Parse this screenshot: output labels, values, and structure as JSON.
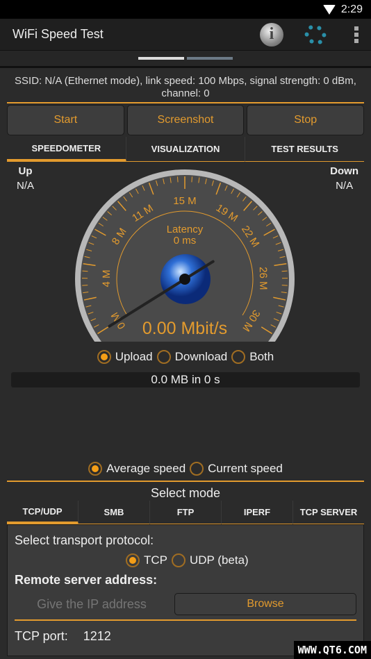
{
  "status": {
    "time": "2:29",
    "icons": [
      "wifi-icon"
    ]
  },
  "appbar": {
    "title": "WiFi Speed Test",
    "icons": [
      "info-icon",
      "gear-icon",
      "overflow-menu-icon"
    ]
  },
  "info": {
    "text": "SSID: N/A (Ethernet mode), link speed: 100 Mbps, signal strength: 0 dBm, channel: 0"
  },
  "buttons": {
    "start": "Start",
    "screenshot": "Screenshot",
    "stop": "Stop"
  },
  "tabs": [
    {
      "label": "SPEEDOMETER",
      "active": true
    },
    {
      "label": "VISUALIZATION"
    },
    {
      "label": "TEST RESULTS"
    }
  ],
  "up": {
    "label": "Up",
    "value": "N/A"
  },
  "down": {
    "label": "Down",
    "value": "N/A"
  },
  "gauge": {
    "scale_labels": [
      "0 M",
      "4 M",
      "8 M",
      "11 M",
      "15 M",
      "19 M",
      "22 M",
      "26 M",
      "30 M"
    ],
    "scale_values": [
      0,
      4,
      8,
      11,
      15,
      19,
      22,
      26,
      30
    ],
    "max": 30,
    "needle_value": 0,
    "latency_label": "Latency",
    "latency_value": "0 ms",
    "speed": "0.00 Mbit/s"
  },
  "direction": {
    "options": [
      "Upload",
      "Download",
      "Both"
    ],
    "selected": "Upload"
  },
  "transfer": "0.0 MB in 0 s",
  "speed_mode": {
    "options": [
      "Average speed",
      "Current speed"
    ],
    "selected": "Average speed"
  },
  "select_mode": "Select mode",
  "mode_tabs": [
    {
      "label": "TCP/UDP",
      "active": true
    },
    {
      "label": "SMB"
    },
    {
      "label": "FTP"
    },
    {
      "label": "IPERF"
    },
    {
      "label": "TCP SERVER"
    }
  ],
  "tcp": {
    "protocol_label": "Select transport protocol:",
    "protocols": [
      "TCP",
      "UDP (beta)"
    ],
    "selected": "TCP",
    "server_label": "Remote server address:",
    "ip_placeholder": "Give the IP address",
    "browse": "Browse",
    "port_label": "TCP port:",
    "port_value": "1212"
  },
  "watermark": "WWW.QT6.COM",
  "colors": {
    "accent": "#e39b2e",
    "background": "#2b2b2b"
  }
}
